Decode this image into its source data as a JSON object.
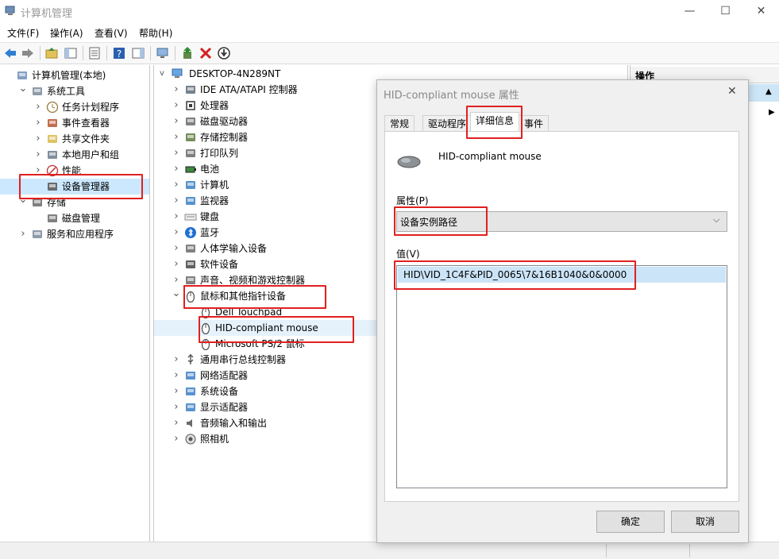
{
  "window": {
    "title": "计算机管理",
    "min": "—",
    "max": "☐",
    "close": "✕"
  },
  "menu": [
    "文件(F)",
    "操作(A)",
    "查看(V)",
    "帮助(H)"
  ],
  "left_tree": [
    {
      "label": "计算机管理(本地)",
      "chev": "",
      "level": 0,
      "icon": "computer-management-icon",
      "color": "#6d8fb8"
    },
    {
      "label": "系统工具",
      "chev": "v",
      "level": 1,
      "icon": "tools-icon",
      "color": "#7a8a99"
    },
    {
      "label": "任务计划程序",
      "chev": ">",
      "level": 2,
      "icon": "clock-icon",
      "color": "#9a7b3a"
    },
    {
      "label": "事件查看器",
      "chev": ">",
      "level": 2,
      "icon": "event-viewer-icon",
      "color": "#b8552f"
    },
    {
      "label": "共享文件夹",
      "chev": ">",
      "level": 2,
      "icon": "shared-folder-icon",
      "color": "#d9b84a"
    },
    {
      "label": "本地用户和组",
      "chev": ">",
      "level": 2,
      "icon": "users-icon",
      "color": "#6b7b8c"
    },
    {
      "label": "性能",
      "chev": ">",
      "level": 2,
      "icon": "performance-icon",
      "color": "#c03030"
    },
    {
      "label": "设备管理器",
      "chev": "",
      "level": 2,
      "icon": "device-manager-icon",
      "color": "#555555"
    },
    {
      "label": "存储",
      "chev": "v",
      "level": 1,
      "icon": "storage-icon",
      "color": "#6a6a6a"
    },
    {
      "label": "磁盘管理",
      "chev": "",
      "level": 2,
      "icon": "disk-icon",
      "color": "#6a6a6a"
    },
    {
      "label": "服务和应用程序",
      "chev": ">",
      "level": 1,
      "icon": "services-icon",
      "color": "#7a8a99"
    }
  ],
  "device_tree": {
    "root": "DESKTOP-4N289NT",
    "items": [
      {
        "label": "IDE ATA/ATAPI 控制器",
        "chev": ">",
        "level": 1,
        "icon": "ide-controller-icon",
        "color": "#5d6b78"
      },
      {
        "label": "处理器",
        "chev": ">",
        "level": 1,
        "icon": "processor-icon",
        "color": "#3a3a3a"
      },
      {
        "label": "磁盘驱动器",
        "chev": ">",
        "level": 1,
        "icon": "disk-drive-icon",
        "color": "#6a6a6a"
      },
      {
        "label": "存储控制器",
        "chev": ">",
        "level": 1,
        "icon": "storage-controller-icon",
        "color": "#5f7a3d"
      },
      {
        "label": "打印队列",
        "chev": ">",
        "level": 1,
        "icon": "printer-icon",
        "color": "#6a6a6a"
      },
      {
        "label": "电池",
        "chev": ">",
        "level": 1,
        "icon": "battery-icon",
        "color": "#3d8a3d"
      },
      {
        "label": "计算机",
        "chev": ">",
        "level": 1,
        "icon": "computer-icon",
        "color": "#3b7fc4"
      },
      {
        "label": "监视器",
        "chev": ">",
        "level": 1,
        "icon": "monitor-icon",
        "color": "#3b7fc4"
      },
      {
        "label": "键盘",
        "chev": ">",
        "level": 1,
        "icon": "keyboard-icon",
        "color": "#8a8a8a"
      },
      {
        "label": "蓝牙",
        "chev": ">",
        "level": 1,
        "icon": "bluetooth-icon",
        "color": "#1f6fd1"
      },
      {
        "label": "人体学输入设备",
        "chev": ">",
        "level": 1,
        "icon": "hid-icon",
        "color": "#6a6a6a"
      },
      {
        "label": "软件设备",
        "chev": ">",
        "level": 1,
        "icon": "software-device-icon",
        "color": "#444444"
      },
      {
        "label": "声音、视频和游戏控制器",
        "chev": ">",
        "level": 1,
        "icon": "audio-icon",
        "color": "#6a6a6a"
      },
      {
        "label": "鼠标和其他指针设备",
        "chev": "v",
        "level": 1,
        "icon": "mouse-icon",
        "color": "#555555"
      },
      {
        "label": "Dell Touchpad",
        "chev": "",
        "level": 2,
        "icon": "mouse-icon",
        "color": "#555555"
      },
      {
        "label": "HID-compliant mouse",
        "chev": "",
        "level": 2,
        "icon": "mouse-icon",
        "color": "#555555"
      },
      {
        "label": "Microsoft PS/2 鼠标",
        "chev": "",
        "level": 2,
        "icon": "mouse-icon",
        "color": "#555555"
      },
      {
        "label": "通用串行总线控制器",
        "chev": ">",
        "level": 1,
        "icon": "usb-icon",
        "color": "#555555"
      },
      {
        "label": "网络适配器",
        "chev": ">",
        "level": 1,
        "icon": "network-adapter-icon",
        "color": "#3b7fc4"
      },
      {
        "label": "系统设备",
        "chev": ">",
        "level": 1,
        "icon": "system-device-icon",
        "color": "#3b7fc4"
      },
      {
        "label": "显示适配器",
        "chev": ">",
        "level": 1,
        "icon": "display-adapter-icon",
        "color": "#3b7fc4"
      },
      {
        "label": "音频输入和输出",
        "chev": ">",
        "level": 1,
        "icon": "speaker-icon",
        "color": "#6a6a6a"
      },
      {
        "label": "照相机",
        "chev": ">",
        "level": 1,
        "icon": "camera-icon",
        "color": "#555555"
      }
    ]
  },
  "actions_pane": {
    "header": "操作"
  },
  "dialog": {
    "title": "HID-compliant mouse 属性",
    "close": "✕",
    "tabs": [
      "常规",
      "驱动程序",
      "详细信息",
      "事件"
    ],
    "active_tab": "详细信息",
    "device_name": "HID-compliant mouse",
    "property_label": "属性(P)",
    "property_value": "设备实例路径",
    "value_label": "值(V)",
    "value_item": "HID\\VID_1C4F&PID_0065\\7&16B1040&0&0000",
    "ok": "确定",
    "cancel": "取消"
  },
  "colors": {
    "highlight": "#e02020",
    "selection": "#cce4f7",
    "list_selected": "#d9e8fb"
  }
}
